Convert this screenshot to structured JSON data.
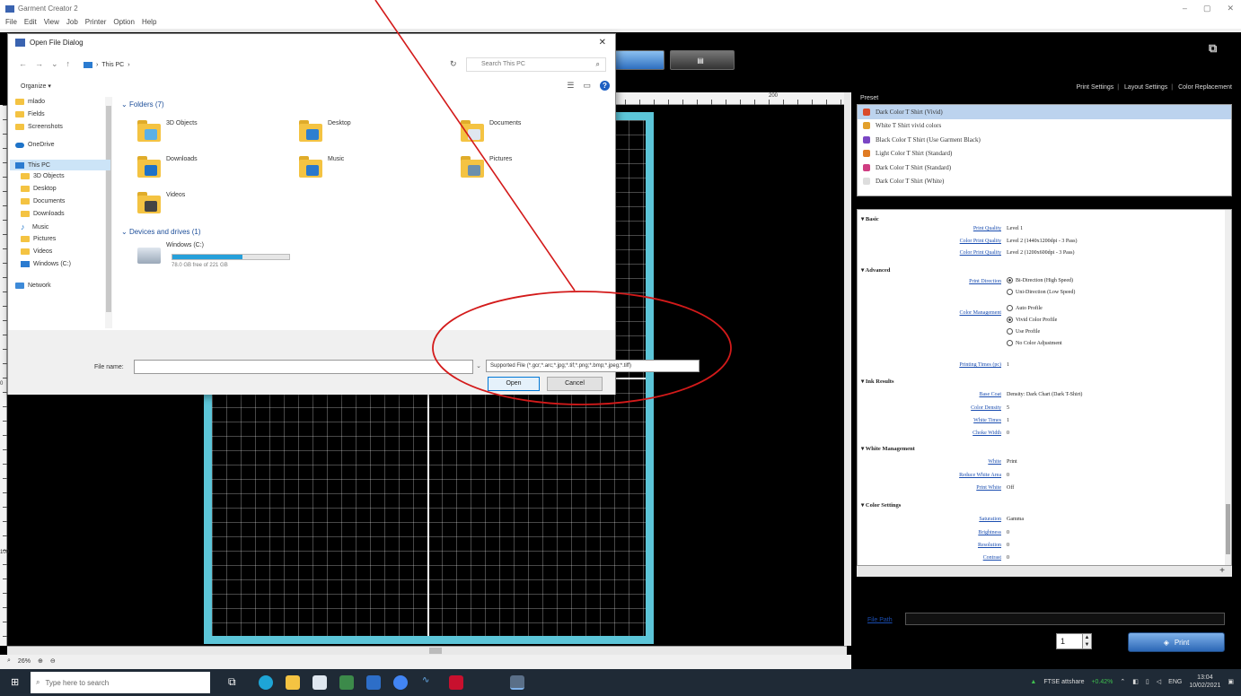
{
  "app": {
    "title": "Garment Creator 2",
    "window_controls": [
      "–",
      "▢",
      "✕"
    ],
    "menu": [
      "File",
      "Edit",
      "View",
      "Job",
      "Printer",
      "Option",
      "Help"
    ]
  },
  "toolbar": {
    "buttons": [
      "",
      ""
    ]
  },
  "ruler": {
    "top_label": "200",
    "left_label_1": "0",
    "left_label_2": "100"
  },
  "status": {
    "zoom": "26%"
  },
  "right_panel": {
    "tabs": [
      "Print Settings",
      "Layout Settings",
      "Color Replacement"
    ],
    "preset_label": "Preset",
    "presets": [
      {
        "label": "Dark Color T Shirt (Vivid)",
        "color": "#d94a2a",
        "selected": true
      },
      {
        "label": "White T Shirt vivid colors",
        "color": "#e3a02b",
        "selected": false
      },
      {
        "label": "Black Color T Shirt (Use Garment Black)",
        "color": "#7a46c4",
        "selected": false
      },
      {
        "label": "Light Color T Shirt (Standard)",
        "color": "#e07b23",
        "selected": false
      },
      {
        "label": "Dark Color T Shirt (Standard)",
        "color": "#cf3d82",
        "selected": false
      },
      {
        "label": "Dark Color T Shirt (White)",
        "color": "#dddddd",
        "selected": false
      }
    ],
    "sections": {
      "basic": "▾ Basic",
      "advanced": "▾ Advanced",
      "ink_results": "▾ Ink Results",
      "white_management": "▾ White Management",
      "color_settings": "▾ Color Settings"
    },
    "settings": {
      "print_quality_label": "Print Quality",
      "print_quality_value": "Level 1",
      "color_print_quality_label": "Color Print Quality",
      "color_print_quality_value": "Level 2 (1440x1200dpi - 3 Pass)",
      "white_print_quality_label": "Color Print Quality",
      "white_print_quality_value": "Level 2 (1200x600dpi - 3 Pass)",
      "print_direction_label": "Print Direction",
      "print_direction_options": [
        "Bi-Direction (High Speed)",
        "Uni-Direction (Low Speed)"
      ],
      "color_management_label": "Color Management",
      "color_management_options": [
        "Auto Profile",
        "Vivid Color Profile",
        "Use Profile",
        "No Color Adjustment"
      ],
      "printing_times_label": "Printing Times (pc)",
      "printing_times_value": "1",
      "base_coat_label": "Base Coat",
      "base_coat_value": "Density: Dark Chart (Dark T-Shirt)",
      "color_density_label": "Color Density",
      "color_density_value": "5",
      "white_times_label": "White Times",
      "white_times_value": "1",
      "choke_width_label": "Choke Width",
      "choke_width_value": "0",
      "white_label": "White",
      "white_value": "Print",
      "reduce_white_label": "Reduce White Area",
      "reduce_white_value": "0",
      "print_white_label": "Print White",
      "print_white_value": "Off",
      "saturation_label": "Saturation",
      "saturation_value": "Gamma",
      "brightness_label": "Brightness",
      "brightness_value": "0",
      "resolution_label": "Resolution",
      "resolution_value": "0",
      "contrast_label": "Contrast",
      "contrast_value": "0"
    },
    "add_symbol": "+",
    "path_link": "File Path",
    "copies": "1",
    "print_label": "Print"
  },
  "dialog": {
    "title": "Open File Dialog",
    "close": "✕",
    "address": "This PC",
    "search_placeholder": "Search This PC",
    "organize": "Organize ▾",
    "nav": [
      {
        "label": "mlado",
        "icon": "folder"
      },
      {
        "label": "Fields",
        "icon": "folder"
      },
      {
        "label": "Screenshots",
        "icon": "folder"
      },
      {
        "label": "OneDrive",
        "icon": "cloud"
      },
      {
        "label": "This PC",
        "icon": "pc"
      },
      {
        "label": "3D Objects",
        "icon": "folder"
      },
      {
        "label": "Desktop",
        "icon": "folder"
      },
      {
        "label": "Documents",
        "icon": "folder"
      },
      {
        "label": "Downloads",
        "icon": "folder"
      },
      {
        "label": "Music",
        "icon": "music"
      },
      {
        "label": "Pictures",
        "icon": "folder"
      },
      {
        "label": "Videos",
        "icon": "folder"
      },
      {
        "label": "Windows (C:)",
        "icon": "pc"
      },
      {
        "label": "Network",
        "icon": "net"
      }
    ],
    "folders_header": "Folders (7)",
    "folders": [
      "3D Objects",
      "Desktop",
      "Documents",
      "Downloads",
      "Music",
      "Pictures",
      "Videos"
    ],
    "drives_header": "Devices and drives (1)",
    "drive_name": "Windows (C:)",
    "drive_usage": 0.6,
    "drive_space": "78.0 GB free of 221 GB",
    "file_name_label": "File name:",
    "file_name_value": "",
    "file_type": "Supported File (*.gcr;*.arc;*.jpg;*.tif;*.png;*.bmp;*.jpeg;*.tiff)",
    "open_label": "Open",
    "cancel_label": "Cancel"
  },
  "taskbar": {
    "search_placeholder": "Type here to search",
    "tray_text": "FTSE attshare",
    "tray_delta": "+0.42%",
    "lang": "ENG",
    "time": "13:04",
    "date": "10/02/2021"
  }
}
